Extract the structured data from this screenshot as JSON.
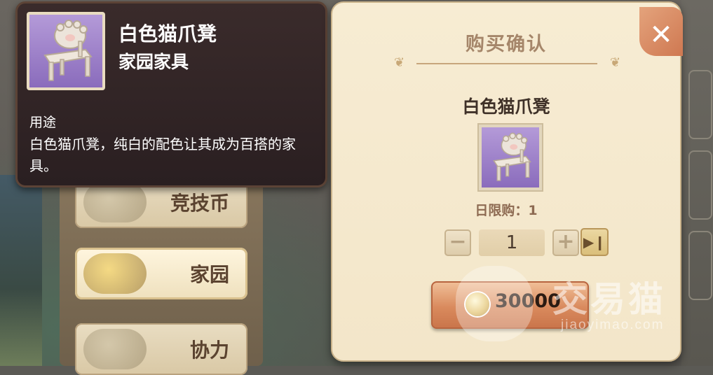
{
  "tooltip": {
    "item_name": "白色猫爪凳",
    "item_category": "家园家具",
    "use_label": "用途",
    "use_description": "白色猫爪凳，纯白的配色让其成为百搭的家具。",
    "icon": "cat-paw-stool-icon"
  },
  "menu": {
    "items": [
      {
        "label": "竞技币"
      },
      {
        "label": "家园"
      },
      {
        "label": "协力"
      }
    ]
  },
  "dialog": {
    "title": "购买确认",
    "product_name": "白色猫爪凳",
    "daily_limit": "日限购：1",
    "quantity": "1",
    "minus_symbol": "−",
    "plus_symbol": "+",
    "max_symbol": "▶❙",
    "price": "30000",
    "close_symbol": "✕"
  },
  "watermark": {
    "text": "交易猫",
    "url": "jiaoyimao.com"
  }
}
